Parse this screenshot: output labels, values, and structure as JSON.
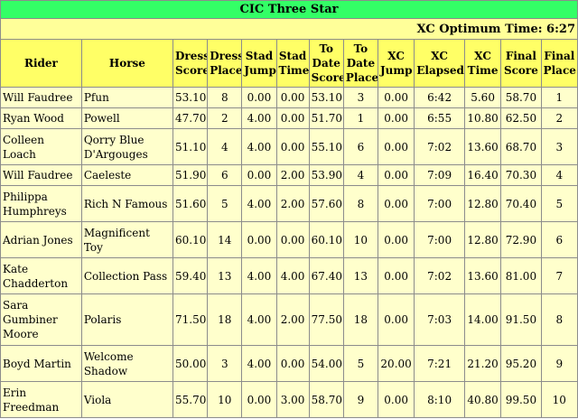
{
  "title": "CIC Three Star",
  "optimum_time": "XC Optimum Time: 6:27",
  "headers": [
    [
      "Rider"
    ],
    [
      "Horse"
    ],
    [
      "Dress",
      "Score"
    ],
    [
      "Dress",
      "Place"
    ],
    [
      "Stad",
      "Jump"
    ],
    [
      "Stad",
      "Time"
    ],
    [
      "To",
      "Date",
      "Score"
    ],
    [
      "To",
      "Date",
      "Place"
    ],
    [
      "XC",
      "Jump"
    ],
    [
      "XC",
      "Elapsed"
    ],
    [
      "XC",
      "Time"
    ],
    [
      "Final",
      "Score"
    ],
    [
      "Final",
      "Place"
    ]
  ],
  "rows": [
    [
      "Will Faudree",
      "Pfun",
      "53.10",
      "8",
      "0.00",
      "0.00",
      "53.10",
      "3",
      "0.00",
      "6:42",
      "5.60",
      "58.70",
      "1"
    ],
    [
      "Ryan Wood",
      "Powell",
      "47.70",
      "2",
      "4.00",
      "0.00",
      "51.70",
      "1",
      "0.00",
      "6:55",
      "10.80",
      "62.50",
      "2"
    ],
    [
      "Colleen Loach",
      "Qorry Blue D'Argouges",
      "51.10",
      "4",
      "4.00",
      "0.00",
      "55.10",
      "6",
      "0.00",
      "7:02",
      "13.60",
      "68.70",
      "3"
    ],
    [
      "Will Faudree",
      "Caeleste",
      "51.90",
      "6",
      "0.00",
      "2.00",
      "53.90",
      "4",
      "0.00",
      "7:09",
      "16.40",
      "70.30",
      "4"
    ],
    [
      "Philippa Humphreys",
      "Rich N Famous",
      "51.60",
      "5",
      "4.00",
      "2.00",
      "57.60",
      "8",
      "0.00",
      "7:00",
      "12.80",
      "70.40",
      "5"
    ],
    [
      "Adrian Jones",
      "Magnificent Toy",
      "60.10",
      "14",
      "0.00",
      "0.00",
      "60.10",
      "10",
      "0.00",
      "7:00",
      "12.80",
      "72.90",
      "6"
    ],
    [
      "Kate Chadderton",
      "Collection Pass",
      "59.40",
      "13",
      "4.00",
      "4.00",
      "67.40",
      "13",
      "0.00",
      "7:02",
      "13.60",
      "81.00",
      "7"
    ],
    [
      "Sara Gumbiner Moore",
      "Polaris",
      "71.50",
      "18",
      "4.00",
      "2.00",
      "77.50",
      "18",
      "0.00",
      "7:03",
      "14.00",
      "91.50",
      "8"
    ],
    [
      "Boyd Martin",
      "Welcome Shadow",
      "50.00",
      "3",
      "4.00",
      "0.00",
      "54.00",
      "5",
      "20.00",
      "7:21",
      "21.20",
      "95.20",
      "9"
    ],
    [
      "Erin Freedman",
      "Viola",
      "55.70",
      "10",
      "0.00",
      "3.00",
      "58.70",
      "9",
      "0.00",
      "8:10",
      "40.80",
      "99.50",
      "10"
    ]
  ]
}
